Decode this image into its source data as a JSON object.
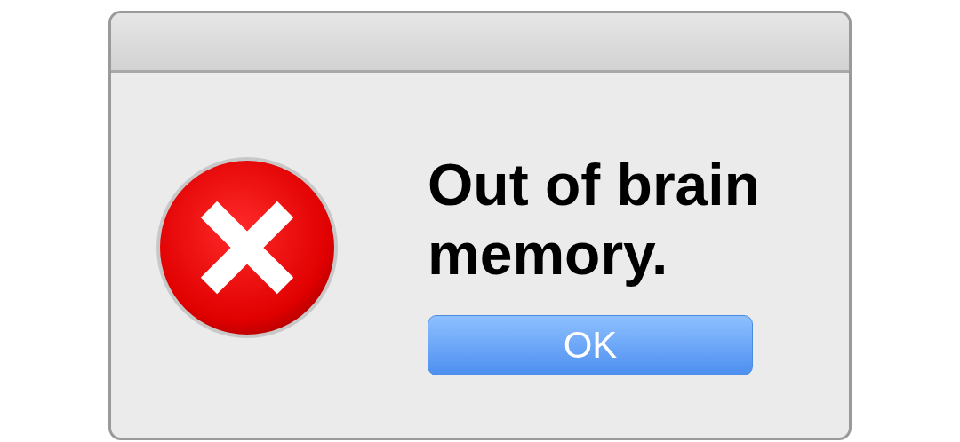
{
  "dialog": {
    "message": "Out of brain memory.",
    "buttons": [
      "OK"
    ]
  }
}
